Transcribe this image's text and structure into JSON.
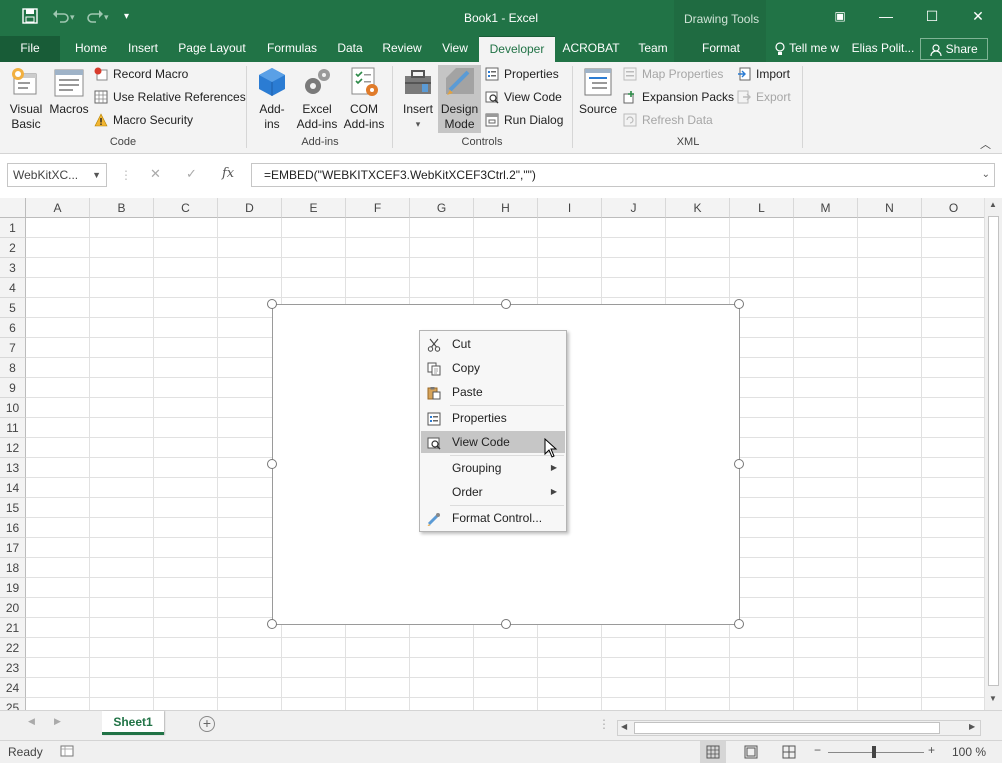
{
  "title_bar": {
    "title": "Book1 - Excel",
    "context_group": "Drawing Tools",
    "qat": {
      "save_icon": "save-icon",
      "undo_icon": "undo-icon",
      "redo_icon": "redo-icon",
      "customize_icon": "customize-qat-icon"
    },
    "window_buttons": {
      "ribbon_options": "▣",
      "minimize": "—",
      "maximize": "☐",
      "close": "✕"
    }
  },
  "tabs": [
    "File",
    "Home",
    "Insert",
    "Page Layout",
    "Formulas",
    "Data",
    "Review",
    "View",
    "Developer",
    "ACROBAT",
    "Team",
    "Format"
  ],
  "active_tab": "Developer",
  "tell_me": "Tell me w",
  "user": "Elias Polit...",
  "share": "Share",
  "ribbon": {
    "code": {
      "label": "Code",
      "visual_basic": [
        "Visual",
        "Basic"
      ],
      "macros": "Macros",
      "record_macro": "Record Macro",
      "relative_refs": "Use Relative References",
      "macro_security": "Macro Security"
    },
    "addins": {
      "label": "Add-ins",
      "addins": [
        "Add-",
        "ins"
      ],
      "excel_addins": [
        "Excel",
        "Add-ins"
      ],
      "com_addins": [
        "COM",
        "Add-ins"
      ]
    },
    "controls": {
      "label": "Controls",
      "insert": "Insert",
      "design_mode": [
        "Design",
        "Mode"
      ],
      "properties": "Properties",
      "view_code": "View Code",
      "run_dialog": "Run Dialog"
    },
    "xml": {
      "label": "XML",
      "source": "Source",
      "map_properties": "Map Properties",
      "expansion_packs": "Expansion Packs",
      "refresh_data": "Refresh Data",
      "import": "Import",
      "export": "Export"
    }
  },
  "formula_bar": {
    "name_box": "WebKitXC...",
    "cancel": "✕",
    "enter": "✓",
    "fx": "fx",
    "formula": "=EMBED(\"WEBKITXCEF3.WebKitXCEF3Ctrl.2\",\"\")"
  },
  "columns": [
    "A",
    "B",
    "C",
    "D",
    "E",
    "F",
    "G",
    "H",
    "I",
    "J",
    "K",
    "L",
    "M",
    "N",
    "O"
  ],
  "rows": [
    "1",
    "2",
    "3",
    "4",
    "5",
    "6",
    "7",
    "8",
    "9",
    "10",
    "11",
    "12",
    "13",
    "14",
    "15",
    "16",
    "17",
    "18",
    "19",
    "20",
    "21",
    "22",
    "23",
    "24",
    "25"
  ],
  "context_menu": {
    "cut": "Cut",
    "copy": "Copy",
    "paste": "Paste",
    "properties": "Properties",
    "view_code": "View Code",
    "grouping": "Grouping",
    "order": "Order",
    "format_control": "Format Control...",
    "highlighted": "View Code"
  },
  "sheets": [
    "Sheet1"
  ],
  "status": {
    "ready": "Ready",
    "zoom": "100 %"
  },
  "colors": {
    "excel_green": "#217346",
    "menu_highlight": "#c6c6c6"
  }
}
